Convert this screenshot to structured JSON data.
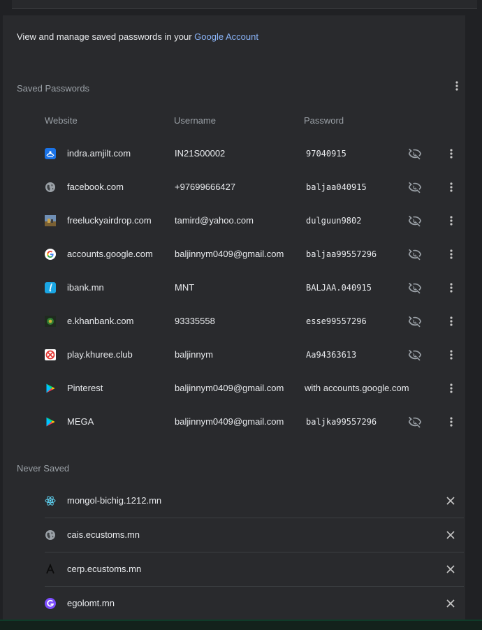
{
  "intro": {
    "text": "View and manage saved passwords in your ",
    "link": "Google Account"
  },
  "saved_passwords": {
    "title": "Saved Passwords",
    "columns": {
      "website": "Website",
      "username": "Username",
      "password": "Password"
    },
    "rows": [
      {
        "site": "indra.amjilt.com",
        "username": "IN21S00002",
        "password": "97040915",
        "icon": "indra-icon"
      },
      {
        "site": "facebook.com",
        "username": "+97699666427",
        "password": "baljaa040915",
        "icon": "globe-icon"
      },
      {
        "site": "freeluckyairdrop.com",
        "username": "tamird@yahoo.com",
        "password": "dulguun9802",
        "icon": "game-thumbnail-icon"
      },
      {
        "site": "accounts.google.com",
        "username": "baljinnym0409@gmail.com",
        "password": "baljaa99557296",
        "icon": "google-icon"
      },
      {
        "site": "ibank.mn",
        "username": "MNT",
        "password": "BALJAA.040915",
        "icon": "ibank-icon"
      },
      {
        "site": "e.khanbank.com",
        "username": "93335558",
        "password": "esse99557296",
        "icon": "khanbank-icon"
      },
      {
        "site": "play.khuree.club",
        "username": "baljinnym",
        "password": "Aa94363613",
        "icon": "khuree-icon"
      },
      {
        "site": "Pinterest",
        "username": "baljinnym0409@gmail.com",
        "password": "with accounts.google.com",
        "icon": "play-store-icon",
        "federated": true
      },
      {
        "site": "MEGA",
        "username": "baljinnym0409@gmail.com",
        "password": "baljka99557296",
        "icon": "play-store-icon"
      }
    ]
  },
  "never_saved": {
    "title": "Never Saved",
    "rows": [
      {
        "site": "mongol-bichig.1212.mn",
        "icon": "react-icon"
      },
      {
        "site": "cais.ecustoms.mn",
        "icon": "globe-icon"
      },
      {
        "site": "cerp.ecustoms.mn",
        "icon": "cerp-logo-icon"
      },
      {
        "site": "egolomt.mn",
        "icon": "golomt-icon"
      }
    ]
  },
  "colors": {
    "background": "#202124",
    "card": "#292a2d",
    "text": "#e8eaed",
    "secondary_text": "#9aa0a6",
    "link": "#8ab4f8"
  }
}
